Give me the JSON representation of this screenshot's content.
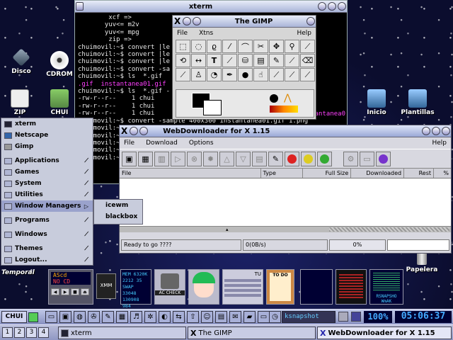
{
  "desktop": {
    "icons": [
      {
        "label": "Disco"
      },
      {
        "label": "CDROM"
      },
      {
        "label": "ZIP"
      },
      {
        "label": "CHUI"
      },
      {
        "label": "Inicio"
      },
      {
        "label": "Plantillas"
      },
      {
        "label": "Temporal"
      },
      {
        "label": "Papelera"
      }
    ]
  },
  "xterm": {
    "title": "xterm",
    "lines": [
      "        xcf =>",
      "       yuv<= m2v",
      "       yuv<= mpg",
      "        zip =>",
      "chuimovil:~$ convert |le",
      "chuimovil:~$ convert |le",
      "chuimovil:~$ convert |le",
      "chuimovil:~$ convert -sa",
      "chuimovil:~$ ls  *.gif",
      ".gif  instantanea01.gif",
      "chuimovil:~$ ls  *.gif -",
      "-rw-r--r--    1 chui",
      "-rw-r--r--    1 chui",
      "-rw-r--r--    1 chui",
      "chuimovil:~$ convert -sample 400x300 instantanea01.gif 1.png",
      "chuimovil:~$",
      "chuimovil:~$",
      "chuimovil:~$",
      "chuimovil:~$",
      "chuimovil:~$"
    ],
    "tail": "antanea0"
  },
  "gimp": {
    "title": "The GIMP",
    "menu": [
      "File",
      "Xtns",
      "Help"
    ]
  },
  "webdownloader": {
    "title": "WebDownloader for X 1.15",
    "menu": [
      "File",
      "Download",
      "Options",
      "Help"
    ],
    "columns": [
      "File",
      "Type",
      "Full Size",
      "Downloaded",
      "Rest",
      "%"
    ],
    "status_text": "Ready to go ????",
    "speed": "0(0B/s)",
    "progress": "0%"
  },
  "start_menu": {
    "items": [
      {
        "label": "xterm"
      },
      {
        "label": "Netscape"
      },
      {
        "label": "Gimp"
      },
      {
        "label": "Applications"
      },
      {
        "label": "Games"
      },
      {
        "label": "System"
      },
      {
        "label": "Utilities"
      },
      {
        "label": "Window Managers"
      },
      {
        "label": "Programs"
      },
      {
        "label": "Windows"
      },
      {
        "label": "Themes"
      },
      {
        "label": "Logout..."
      }
    ],
    "submenu": [
      "icewm",
      "blackbox"
    ]
  },
  "dock": {
    "ascd_top": "AScd",
    "ascd_bottom": "NO CD",
    "mem_label": "MEM",
    "mem_val": "6320K",
    "load": "2212 35",
    "swap_label": "SWAP",
    "swap_val": "33048",
    "other": "130908 984",
    "tu_label": "TU",
    "todo_label": "TO DO",
    "acheck_label": "AC CHECK",
    "net_label": "RSNAPSHO",
    "wmak_label": "WmAK"
  },
  "launchbar": {
    "start_label": "CHUI",
    "ksnapshot": "ksnapshot",
    "lcd1": "100%",
    "clock": "05:06:37"
  },
  "taskbar": {
    "pages": [
      "1",
      "2",
      "3",
      "4"
    ],
    "tasks": [
      "xterm",
      "The GIMP",
      "WebDownloader for X 1.15"
    ]
  },
  "colors": {
    "accent": "#9aa2cc",
    "xterm_bg": "#000000",
    "desktop_bg": "#0b0d2e"
  }
}
